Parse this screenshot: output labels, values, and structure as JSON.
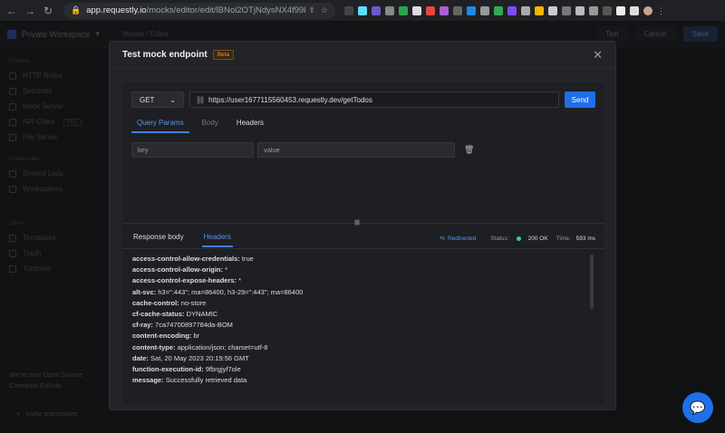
{
  "browser": {
    "url_host": "app.requestly.io",
    "url_path": "/mocks/editor/edit/lBNol2OTjNdysNX4f99l"
  },
  "app": {
    "workspace": "Private Workspace",
    "breadcrumb": "Mocks  /  Editor",
    "buttons": {
      "test": "Test",
      "cancel": "Cancel",
      "save": "Save"
    },
    "sidebar": {
      "sections": [
        {
          "title": "Product",
          "items": [
            "HTTP Rules",
            "Sessions",
            "Mock Server",
            "API Client",
            "File Server"
          ]
        },
        {
          "title": "Collaborate",
          "items": [
            "Shared Lists",
            "Workspaces"
          ]
        },
        {
          "title": "Other",
          "items": [
            "Templates",
            "Trash",
            "Tutorials"
          ]
        }
      ],
      "beta_label": "Beta",
      "footer_line1": "We're now Open Source",
      "footer_line2": "Checkout GitHub",
      "invite": "Invite teammates"
    }
  },
  "modal": {
    "title": "Test mock endpoint",
    "badge": "Beta",
    "request": {
      "method": "GET",
      "url": "https://user1677115560453.requestly.dev/getTodos",
      "send_label": "Send"
    },
    "tabs": [
      "Query Params",
      "Body",
      "Headers"
    ],
    "query_params": {
      "key_placeholder": "key",
      "value_placeholder": "value"
    },
    "response": {
      "tabs": [
        "Response body",
        "Headers"
      ],
      "redirected": "Redirected",
      "status_label": "Status:",
      "status_value": "200 OK",
      "time_label": "Time:",
      "time_value": "593 ms",
      "headers": [
        {
          "key": "access-control-allow-credentials:",
          "value": "true"
        },
        {
          "key": "access-control-allow-origin:",
          "value": "*"
        },
        {
          "key": "access-control-expose-headers:",
          "value": "*"
        },
        {
          "key": "alt-svc:",
          "value": "h3=\":443\"; ma=86400, h3-29=\":443\"; ma=86400"
        },
        {
          "key": "cache-control:",
          "value": "no-store"
        },
        {
          "key": "cf-cache-status:",
          "value": "DYNAMIC"
        },
        {
          "key": "cf-ray:",
          "value": "7ca74700897784da-BOM"
        },
        {
          "key": "content-encoding:",
          "value": "br"
        },
        {
          "key": "content-type:",
          "value": "application/json; charset=utf-8"
        },
        {
          "key": "date:",
          "value": "Sat, 20 May 2023 20:19:56 GMT"
        },
        {
          "key": "function-execution-id:",
          "value": "9fbrgjyf7ole"
        },
        {
          "key": "message:",
          "value": "Successfully retrieved data"
        }
      ]
    }
  },
  "colors": {
    "accent": "#1f6fe8",
    "status_ok": "#3ecf8e",
    "beta": "#e69a44"
  }
}
